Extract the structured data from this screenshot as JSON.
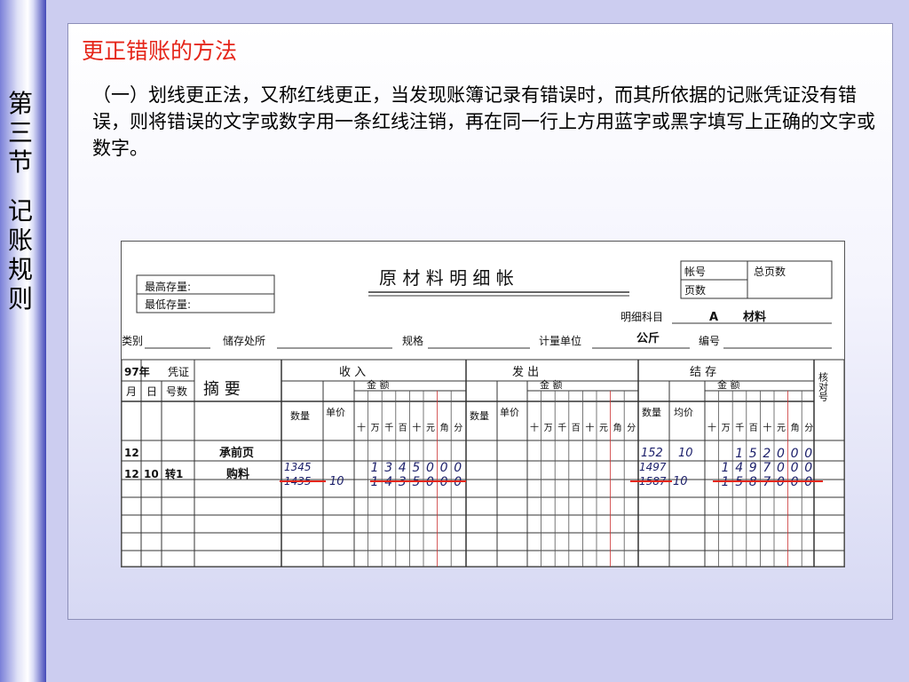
{
  "sidebar": {
    "section_chars": [
      "第",
      "三",
      "节",
      "记",
      "账",
      "规",
      "则"
    ]
  },
  "heading": "更正错账的方法",
  "body": "（一）划线更正法，又称红线更正，当发现账簿记录有错误时，而其所依据的记账凭证没有错误，则将错误的文字或数字用一条红线注销，再在同一行上方用蓝字或黑字填写上正确的文字或数字。",
  "ledger": {
    "title": "原 材 料 明 细 帐",
    "stock_box": {
      "max": "最高存量:",
      "min": "最低存量:"
    },
    "account_box": {
      "account_no": "帐号",
      "total_pages": "总页数",
      "page_count": "页数"
    },
    "detail_subject_label": "明细科目",
    "detail_subject_value": "A",
    "material_label": "材料",
    "category_label": "类别",
    "storage_label": "储存处所",
    "spec_label": "规格",
    "unit_label": "计量单位",
    "unit_value": "公斤",
    "code_label": "编号",
    "headers": {
      "year": "97年",
      "voucher_top": "凭证",
      "month": "月",
      "day": "日",
      "voucher_no": "号数",
      "summary": "摘 要",
      "receive": "收   入",
      "issue": "发   出",
      "balance": "结   存",
      "check": "核对号",
      "qty": "数量",
      "unit_price": "单价",
      "avg_price": "均价",
      "amount": "金   额",
      "digits": [
        "十",
        "万",
        "千",
        "百",
        "十",
        "元",
        "角",
        "分"
      ]
    },
    "rows": [
      {
        "month": "12",
        "day": "",
        "voucher": "",
        "summary": "承前页",
        "in_qty": "",
        "in_price": "",
        "in_amount": "",
        "bal_qty": "152",
        "bal_price": "10",
        "bal_amount": "152000"
      },
      {
        "month": "12",
        "day": "10",
        "voucher": "转1",
        "summary": "购料",
        "in_qty_correct": "1345",
        "in_qty_wrong": "1435",
        "in_price": "10",
        "in_amount_correct": "1345000",
        "in_amount_wrong": "1435000",
        "bal_qty_correct": "1497",
        "bal_qty_wrong": "1587",
        "bal_price": "10",
        "bal_amount_correct": "1497000",
        "bal_amount_wrong": "1587000"
      }
    ],
    "colors": {
      "correction_line": "#e5261a",
      "ink": "#1b1f6a"
    }
  }
}
